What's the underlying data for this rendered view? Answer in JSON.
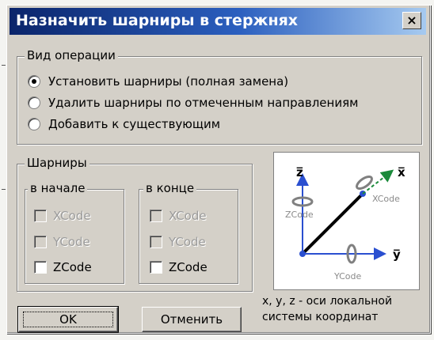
{
  "window": {
    "title": "Назначить шарниры в стержнях",
    "close_label": "×"
  },
  "operation": {
    "legend": "Вид операции",
    "options": [
      {
        "label": "Установить шарниры (полная замена)",
        "selected": true
      },
      {
        "label": "Удалить шарниры по отмеченным направлениям",
        "selected": false
      },
      {
        "label": "Добавить к существующим",
        "selected": false
      }
    ]
  },
  "hinges": {
    "legend": "Шарниры",
    "start": {
      "legend": "в начале",
      "items": [
        {
          "label": "XCode",
          "enabled": false,
          "checked": false
        },
        {
          "label": "YCode",
          "enabled": false,
          "checked": false
        },
        {
          "label": "ZCode",
          "enabled": true,
          "checked": false
        }
      ]
    },
    "end": {
      "legend": "в конце",
      "items": [
        {
          "label": "XCode",
          "enabled": false,
          "checked": false
        },
        {
          "label": "YCode",
          "enabled": false,
          "checked": false
        },
        {
          "label": "ZCode",
          "enabled": true,
          "checked": false
        }
      ]
    }
  },
  "diagram": {
    "axis_z": "z̅",
    "axis_x": "x̅",
    "axis_y": "y̅",
    "label_zcode": "ZCode",
    "label_xcode": "XCode",
    "label_ycode": "YCode",
    "colors": {
      "rod": "#000000",
      "axis": "#2a4fd0",
      "rotation": "#808080",
      "x_arrow": "#1a8a3a"
    }
  },
  "note": {
    "line1": "x, y, z - оси локальной",
    "line2": "системы координат"
  },
  "buttons": {
    "ok": "OK",
    "cancel": "Отменить"
  }
}
